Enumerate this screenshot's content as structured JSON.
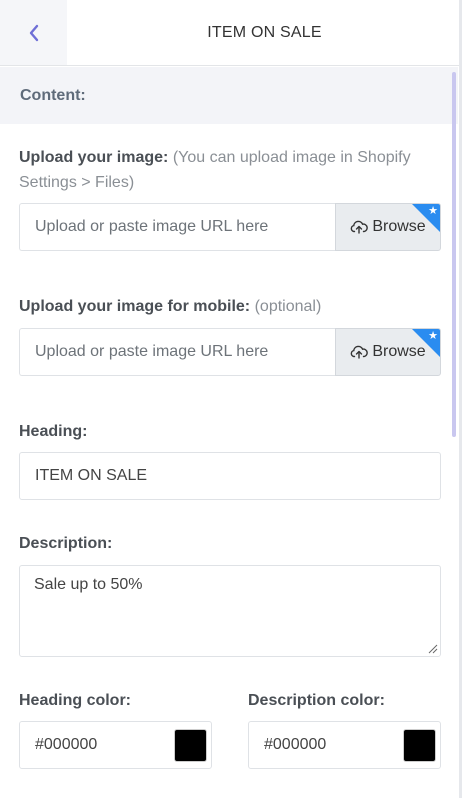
{
  "header": {
    "back_icon": "chevron-left-icon",
    "title": "ITEM ON SALE"
  },
  "section": {
    "title": "Content:"
  },
  "upload_image": {
    "label": "Upload your image:",
    "hint": "(You can upload image in Shopify Settings > Files)",
    "placeholder": "Upload or paste image URL here",
    "browse_label": "Browse",
    "browse_icon": "cloud-upload-icon"
  },
  "upload_mobile": {
    "label": "Upload your image for mobile:",
    "hint": "(optional)",
    "placeholder": "Upload or paste image URL here",
    "browse_label": "Browse",
    "browse_icon": "cloud-upload-icon"
  },
  "heading": {
    "label": "Heading:",
    "value": "ITEM ON SALE"
  },
  "description": {
    "label": "Description:",
    "value": "Sale up to 50%"
  },
  "heading_color": {
    "label": "Heading color:",
    "value": "#000000",
    "swatch": "#000000"
  },
  "description_color": {
    "label": "Description color:",
    "value": "#000000",
    "swatch": "#000000"
  },
  "colors": {
    "accent": "#2a8cf0",
    "back_icon": "#6f6fd6",
    "scrollbar": "#c9c7ef"
  }
}
